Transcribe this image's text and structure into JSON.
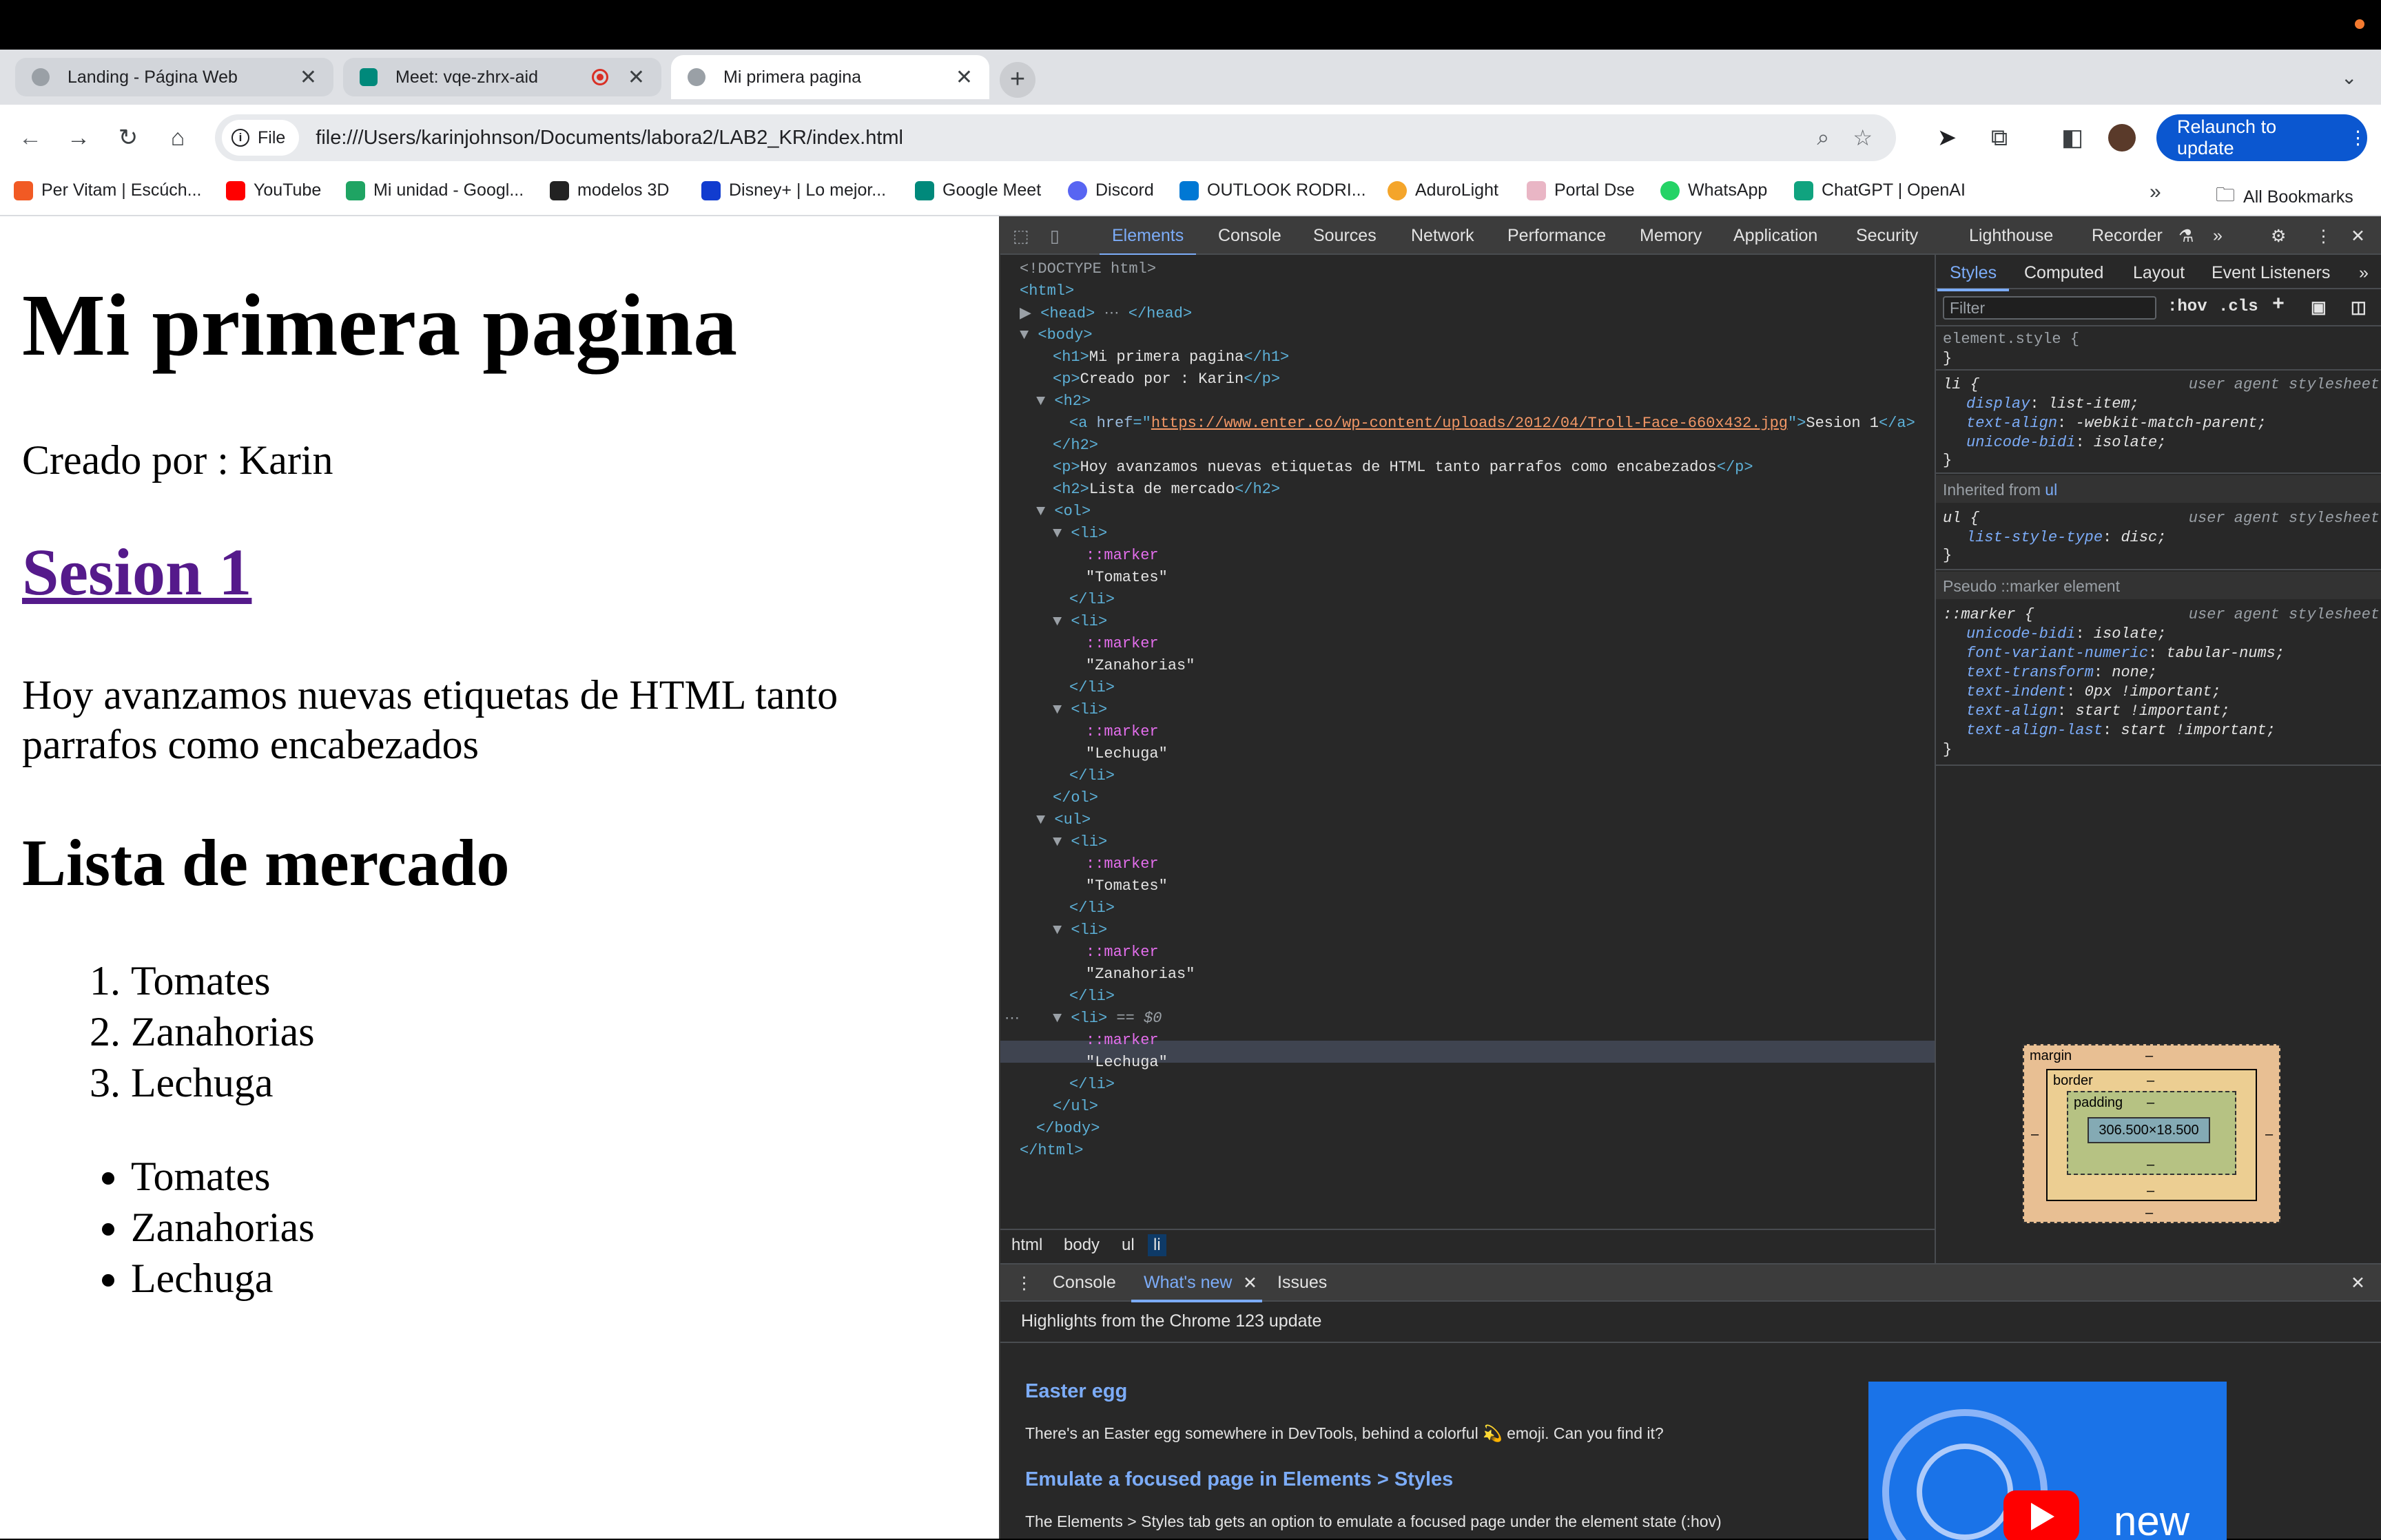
{
  "tabs": [
    {
      "title": "Landing - Página Web"
    },
    {
      "title": "Meet: vqe-zhrx-aid"
    },
    {
      "title": "Mi primera pagina"
    }
  ],
  "toolbar": {
    "scheme": "File",
    "url": "file:///Users/karinjohnson/Documents/labora2/LAB2_KR/index.html",
    "relaunch": "Relaunch to update"
  },
  "bookmarks": [
    {
      "label": "Per Vitam | Escúch...",
      "color": "#f15a24"
    },
    {
      "label": "YouTube",
      "color": "#ff0000"
    },
    {
      "label": "Mi unidad - Googl...",
      "color": "#1fa463"
    },
    {
      "label": "modelos 3D",
      "color": "#222222"
    },
    {
      "label": "Disney+ | Lo mejor...",
      "color": "#113ccf"
    },
    {
      "label": "Google Meet",
      "color": "#00897b"
    },
    {
      "label": "Discord",
      "color": "#5865f2"
    },
    {
      "label": "OUTLOOK  RODRI...",
      "color": "#0078d4"
    },
    {
      "label": "AduroLight",
      "color": "#f4a52b"
    },
    {
      "label": "Portal Dse",
      "color": "#e9b6c5"
    },
    {
      "label": "WhatsApp",
      "color": "#25d366"
    },
    {
      "label": "ChatGPT | OpenAI",
      "color": "#10a37f"
    }
  ],
  "all_bookmarks": "All Bookmarks",
  "page": {
    "h1": "Mi primera pagina",
    "created_by": "Creado por : Karin",
    "link": "Sesion 1",
    "description": "Hoy avanzamos nuevas etiquetas de HTML tanto parrafos como encabezados",
    "list_title": "Lista de mercado",
    "ordered": [
      "Tomates",
      "Zanahorias",
      "Lechuga"
    ],
    "unordered": [
      "Tomates",
      "Zanahorias",
      "Lechuga"
    ]
  },
  "devtools": {
    "tabs": [
      "Elements",
      "Console",
      "Sources",
      "Network",
      "Performance",
      "Memory",
      "Application",
      "Security",
      "Lighthouse",
      "Recorder"
    ],
    "dom": {
      "doctype": "<!DOCTYPE html>",
      "href": "https://www.enter.co/wp-content/uploads/2012/04/Troll-Face-660x432.jpg",
      "link_text": "Sesion 1",
      "h1_text": "Mi primera pagina",
      "p_text": "Creado por : Karin",
      "p2_text": "Hoy avanzamos nuevas etiquetas de HTML tanto parrafos como encabezados",
      "h2_text": "Lista de mercado",
      "marker": "::marker",
      "items": [
        "\"Tomates\"",
        "\"Zanahorias\"",
        "\"Lechuga\""
      ],
      "selected_suffix": "== $0"
    },
    "breadcrumb": [
      "html",
      "body",
      "ul",
      "li"
    ],
    "styles_tabs": [
      "Styles",
      "Computed",
      "Layout",
      "Event Listeners"
    ],
    "filter_placeholder": "Filter",
    "hov": ":hov",
    "cls": ".cls",
    "element_style": "element.style {",
    "ua_label": "user agent stylesheet",
    "inherited": "Inherited from",
    "inherited_tag": "ul",
    "pseudo_section": "Pseudo ::marker element",
    "li_rule": {
      "selector": "li {",
      "props": [
        [
          "display",
          "list-item;"
        ],
        [
          "text-align",
          "-webkit-match-parent;"
        ],
        [
          "unicode-bidi",
          "isolate;"
        ]
      ]
    },
    "ul_rule": {
      "selector": "ul {",
      "props": [
        [
          "list-style-type",
          "disc;"
        ]
      ]
    },
    "marker_rule": {
      "selector": "::marker {",
      "props": [
        [
          "unicode-bidi",
          "isolate;"
        ],
        [
          "font-variant-numeric",
          "tabular-nums;"
        ],
        [
          "text-transform",
          "none;"
        ],
        [
          "text-indent",
          "0px !important;"
        ],
        [
          "text-align",
          "start !important;"
        ],
        [
          "text-align-last",
          "start !important;"
        ]
      ]
    },
    "boxmodel": {
      "margin": "margin",
      "border": "border",
      "padding": "padding",
      "dash": "–",
      "content": "306.500×18.500"
    },
    "drawer_tabs": [
      "Console",
      "What's new",
      "Issues"
    ],
    "highlights": "Highlights from the Chrome 123 update",
    "whatsnew": [
      {
        "title": "Easter egg",
        "body": "There's an Easter egg somewhere in DevTools, behind a colorful 💫 emoji. Can you find it?"
      },
      {
        "title": "Emulate a focused page in Elements > Styles",
        "body": "The Elements > Styles tab gets an option to emulate a focused page under the element state (:hov)"
      }
    ],
    "thumb_text": "new"
  }
}
